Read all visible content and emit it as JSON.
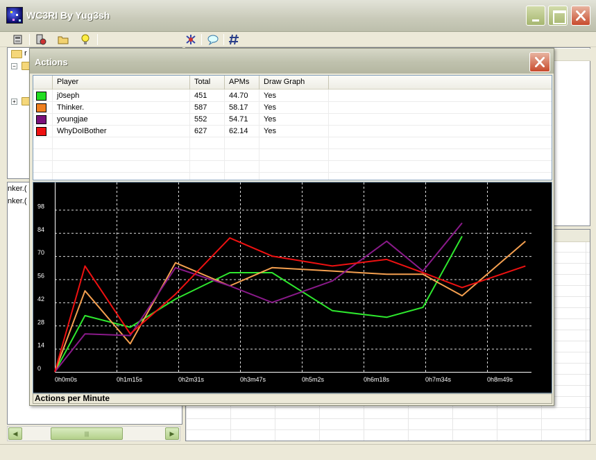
{
  "window": {
    "title": "WC3RI By Yug3sh"
  },
  "toolbar": {
    "buttons": [
      "open-replay-icon",
      "settings-icon",
      "folder-icon",
      "lightbulb-icon",
      "network-icon",
      "chat-icon",
      "hash-icon"
    ]
  },
  "left_tree": {
    "root_fragment": "r"
  },
  "left_list": {
    "rows": [
      "nker.(",
      "nker.("
    ]
  },
  "dialog": {
    "title": "Actions",
    "footer": "Actions per Minute"
  },
  "players_table": {
    "columns": [
      "Player",
      "Total",
      "APMs",
      "Draw Graph"
    ],
    "rows": [
      {
        "color": "#22dd22",
        "player": "j0seph",
        "total": "451",
        "apm": "44.70",
        "draw": "Yes"
      },
      {
        "color": "#f08020",
        "player": "Thinker.",
        "total": "587",
        "apm": "58.17",
        "draw": "Yes"
      },
      {
        "color": "#7a117a",
        "player": "youngjae",
        "total": "552",
        "apm": "54.71",
        "draw": "Yes"
      },
      {
        "color": "#ee1111",
        "player": "WhyDoIBother",
        "total": "627",
        "apm": "62.14",
        "draw": "Yes"
      }
    ]
  },
  "chart_data": {
    "type": "line",
    "title": "Actions per Minute",
    "y_ticks": [
      0,
      14,
      28,
      42,
      56,
      70,
      84,
      98
    ],
    "ylim": [
      0,
      112
    ],
    "x_tick_labels": [
      "0h0m0s",
      "0h1m15s",
      "0h2m31s",
      "0h3m47s",
      "0h5m2s",
      "0h6m18s",
      "0h7m34s",
      "0h8m49s"
    ],
    "x_points": [
      0,
      0.5,
      1.25,
      2,
      2.9,
      3.6,
      4.6,
      5.5,
      6.1,
      6.75,
      7.8
    ],
    "xlim": [
      0,
      7.9
    ],
    "grid": true,
    "series": [
      {
        "name": "j0seph",
        "color": "#2ee82e",
        "values": [
          0,
          34,
          27,
          44,
          60,
          60,
          37,
          33,
          39,
          82,
          null
        ]
      },
      {
        "name": "Thinker.",
        "color": "#f5a050",
        "values": [
          0,
          49,
          17,
          66,
          52,
          63,
          61,
          59,
          59,
          46,
          79
        ]
      },
      {
        "name": "youngjae",
        "color": "#8a1a8a",
        "values": [
          0,
          23,
          22,
          63,
          52,
          42,
          55,
          79,
          61,
          90,
          null
        ]
      },
      {
        "name": "WhyDoIBother",
        "color": "#ee1111",
        "values": [
          0,
          64,
          23,
          47,
          81,
          70,
          64,
          68,
          60,
          51,
          64
        ]
      }
    ]
  }
}
